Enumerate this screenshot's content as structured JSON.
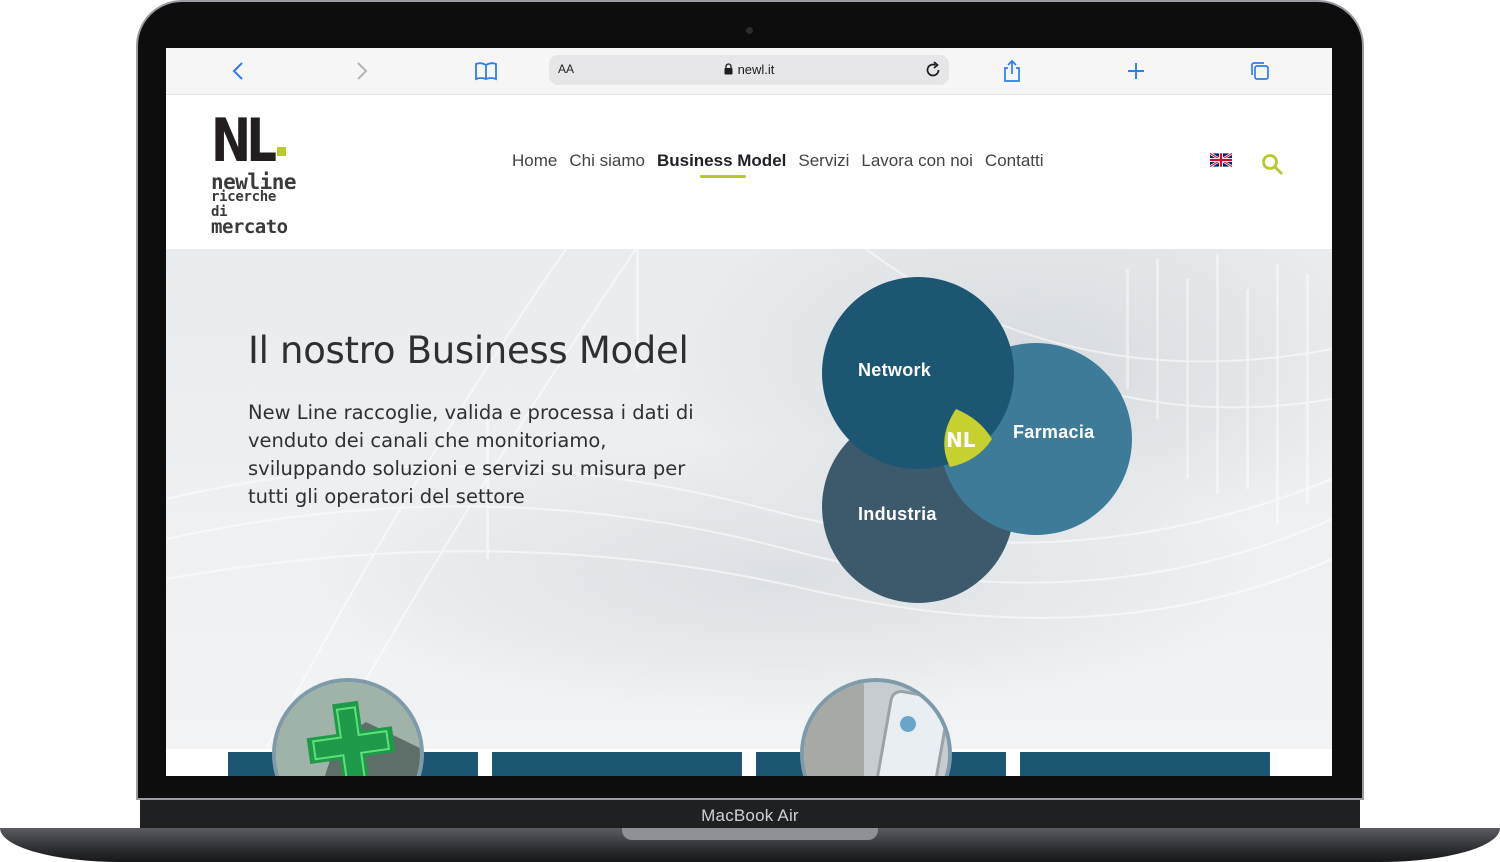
{
  "device": {
    "label": "MacBook Air"
  },
  "browser": {
    "text_size_button": "AA",
    "url": "newl.it",
    "icons": [
      "back-icon",
      "forward-icon",
      "bookmarks-icon",
      "lock-icon",
      "reload-icon",
      "share-icon",
      "new-tab-icon",
      "tabs-icon"
    ]
  },
  "logo": {
    "mark": "NL",
    "line1": "newline",
    "line2": "ricerche di",
    "line3": "mercato"
  },
  "nav": {
    "items": [
      {
        "label": "Home"
      },
      {
        "label": "Chi siamo"
      },
      {
        "label": "Business Model",
        "active": true
      },
      {
        "label": "Servizi"
      },
      {
        "label": "Lavora con noi"
      },
      {
        "label": "Contatti"
      }
    ],
    "language_icon": "uk-flag-icon",
    "search_icon": "search-icon"
  },
  "hero": {
    "title": "Il nostro Business Model",
    "text": "New Line raccoglie, valida e processa i dati di venduto dei canali che monitoriamo, sviluppando soluzioni e servizi su misura per tutti gli operatori del settore"
  },
  "venn": {
    "network": "Network",
    "farmacia": "Farmacia",
    "industria": "Industria",
    "center": "NL"
  },
  "colors": {
    "accent": "#b9c92a",
    "network": "#1d5673",
    "farmacia": "#3e7b99",
    "industria": "#3c5a6b"
  }
}
